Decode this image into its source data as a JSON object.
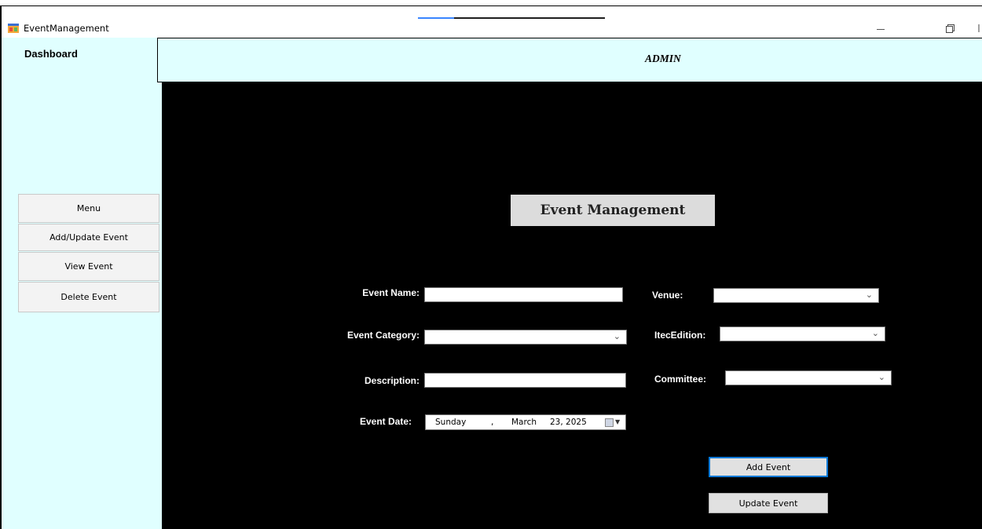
{
  "window": {
    "title": "EventManagement",
    "icon": "app-form-icon"
  },
  "sidebar": {
    "title": "Dashboard",
    "items": [
      {
        "label": "Menu"
      },
      {
        "label": "Add/Update  Event"
      },
      {
        "label": "View Event"
      },
      {
        "label": "Delete Event"
      }
    ]
  },
  "header": {
    "title": "ADMIN"
  },
  "main": {
    "section_title": "Event Management"
  },
  "form": {
    "event_name_label": "Event Name:",
    "event_name_value": "",
    "event_category_label": "Event Category:",
    "event_category_value": "",
    "description_label": "Description:",
    "description_value": "",
    "event_date_label": "Event Date:",
    "event_date": {
      "weekday": "Sunday",
      "separator": ",",
      "month": "March",
      "day_year": "23, 2025"
    },
    "venue_label": "Venue:",
    "venue_value": "",
    "itec_edition_label": "ItecEdition:",
    "itec_edition_value": "",
    "committee_label": "Committee:",
    "committee_value": ""
  },
  "actions": {
    "add_label": "Add Event",
    "update_label": "Update Event"
  },
  "colors": {
    "panel_bg": "#e0ffff",
    "main_bg": "#000000",
    "focus_border": "#0078d7"
  }
}
